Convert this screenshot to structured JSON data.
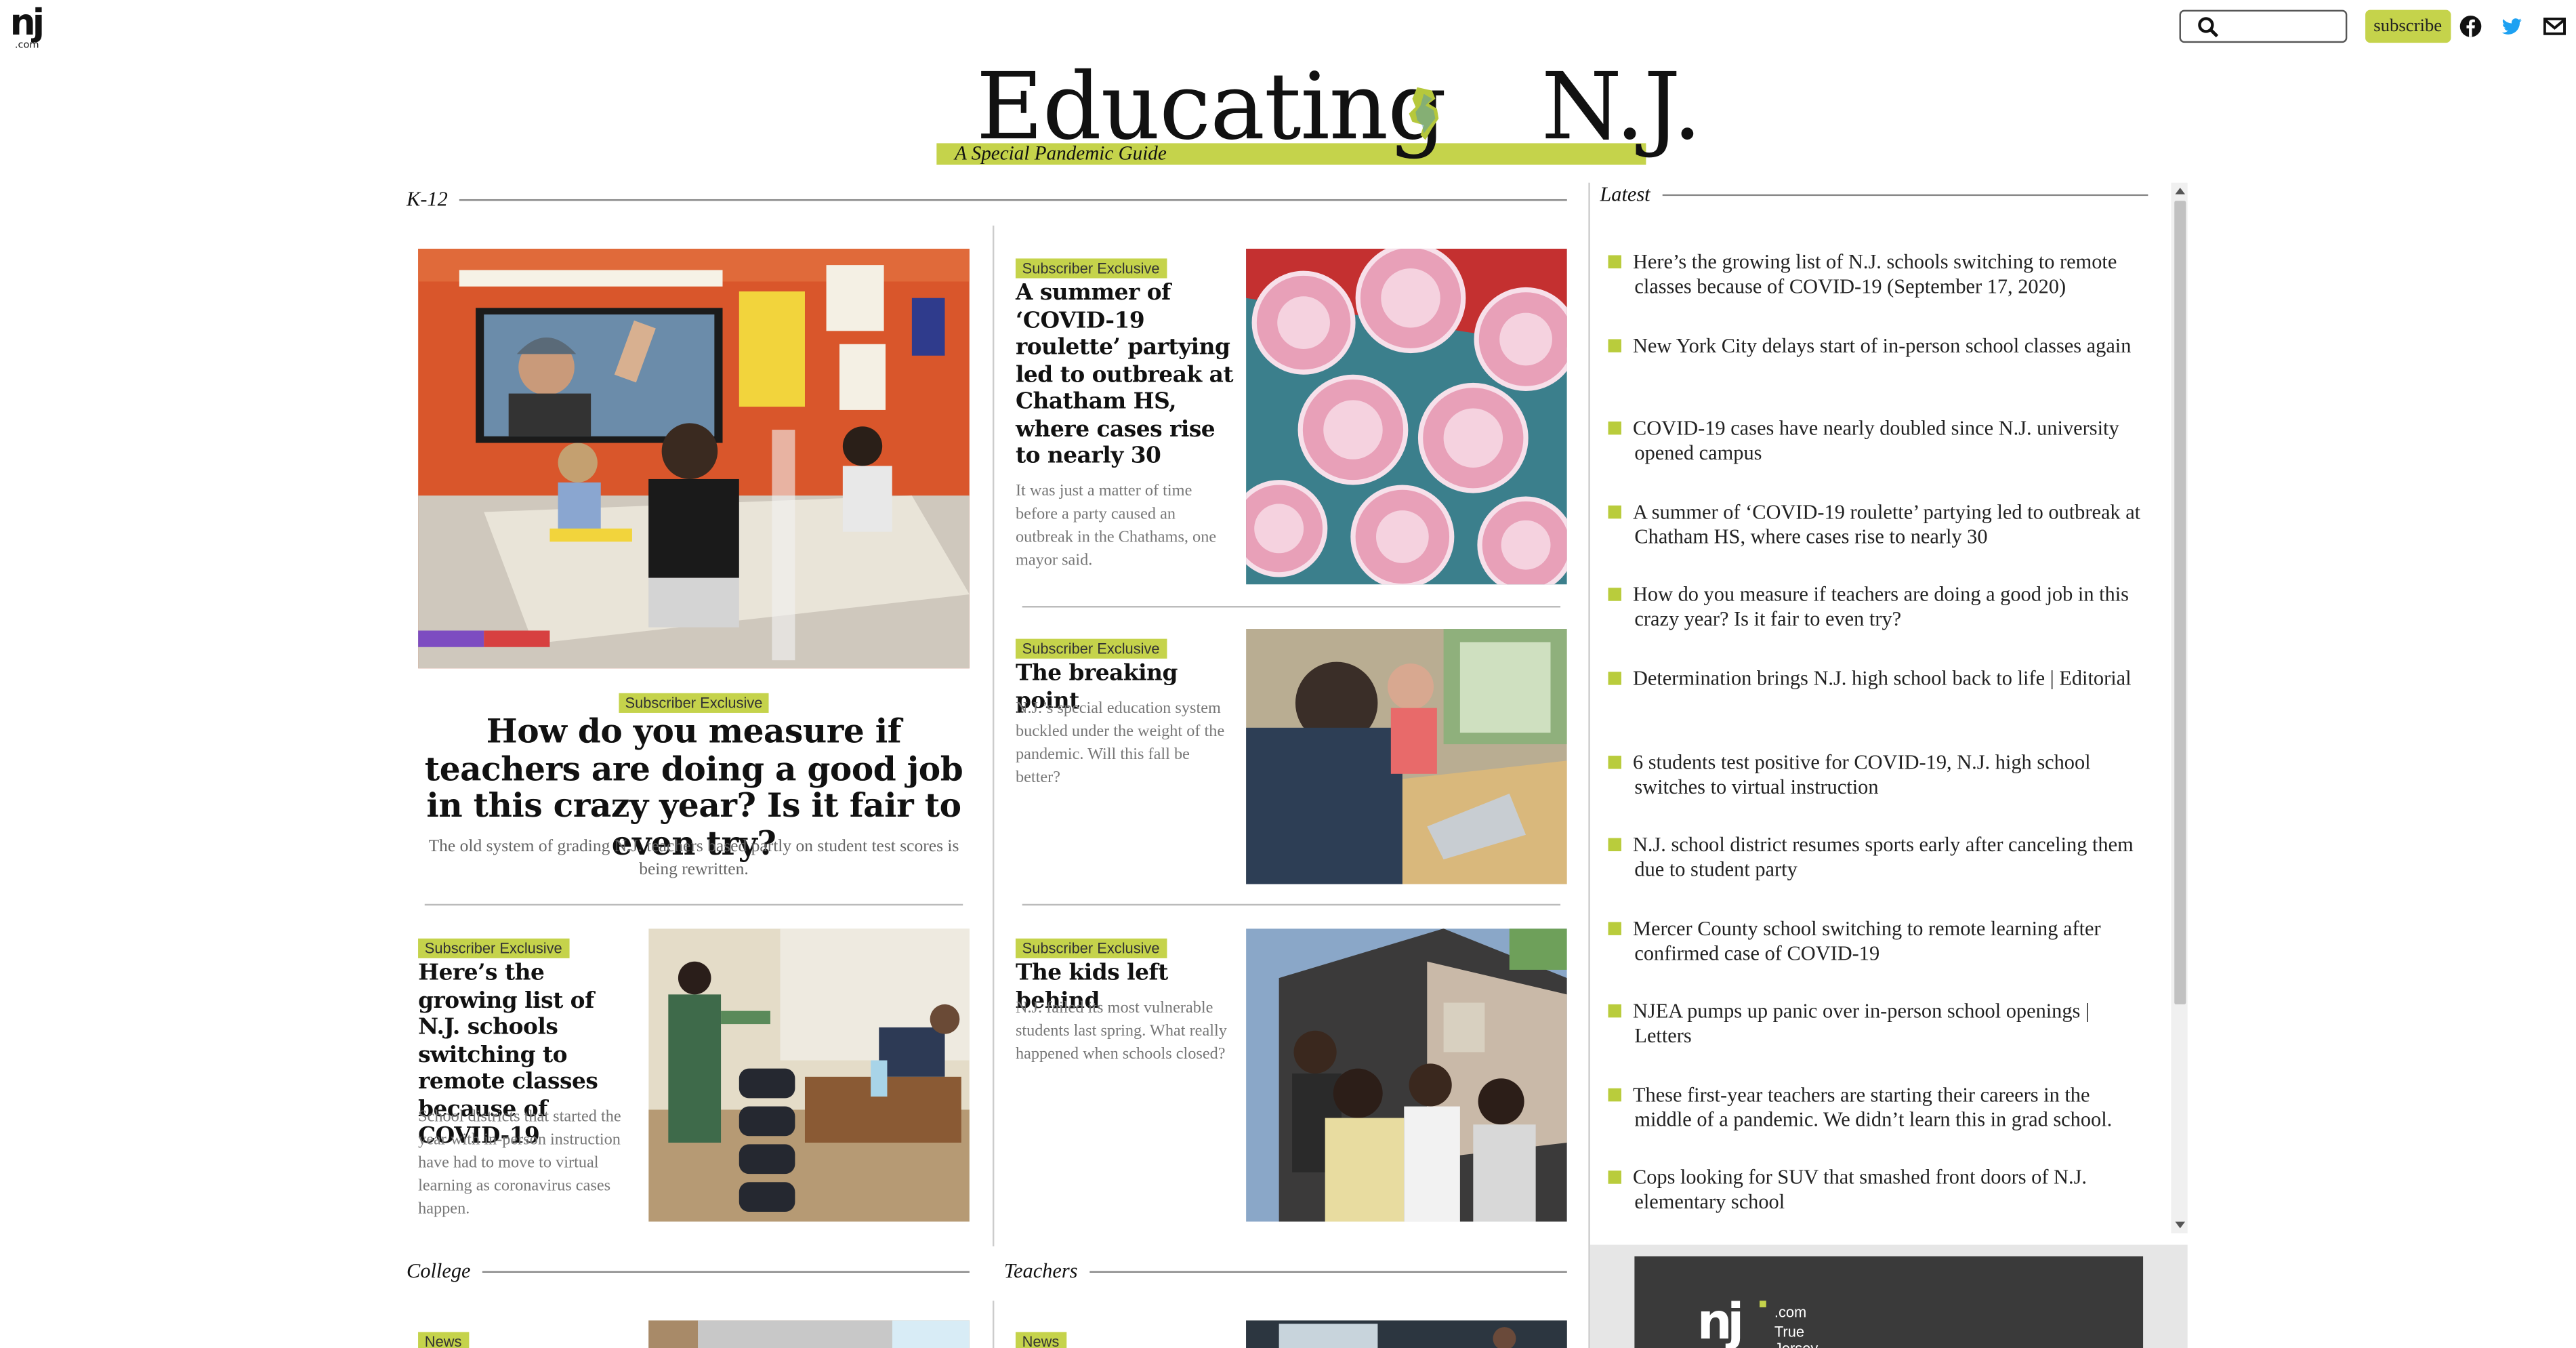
{
  "header": {
    "logo_text": "nj",
    "logo_sub": ".com",
    "search_placeholder": "",
    "subscribe_label": "subscribe",
    "social": [
      "facebook-icon",
      "twitter-icon",
      "mail-icon"
    ]
  },
  "masthead": {
    "title_left": "Educating",
    "title_right": "N.J.",
    "subtitle": "A Special Pandemic Guide",
    "accent": "#c5d34b"
  },
  "sections": {
    "k12": "K-12",
    "latest": "Latest",
    "college": "College",
    "teachers": "Teachers"
  },
  "lead": {
    "badge": "Subscriber Exclusive",
    "headline": "How do you measure if teachers are doing a good job in this crazy year? Is it fair to even try?",
    "dek": "The old system of grading N.J. teachers based partly on student test scores is being rewritten."
  },
  "cards": [
    {
      "badge": "Subscriber Exclusive",
      "headline": "A summer of ‘COVID-19 roulette’ partying led to outbreak at Chatham HS, where cases rise to nearly 30",
      "dek": "It was just a matter of time before a party caused an outbreak in the Chathams, one mayor said."
    },
    {
      "badge": "Subscriber Exclusive",
      "headline": "The breaking point",
      "dek": "N.J.’s special education system buckled under the weight of the pandemic. Will this fall be better?"
    },
    {
      "badge": "Subscriber Exclusive",
      "headline": "Here’s the growing list of N.J. schools switching to remote classes because of COVID-19",
      "dek": "School districts that started the year with in-person instruction have had to move to virtual learning as coronavirus cases happen."
    },
    {
      "badge": "Subscriber Exclusive",
      "headline": "The kids left behind",
      "dek": "N.J. failed its most vulnerable students last spring. What really happened when schools closed?"
    }
  ],
  "bottom_badges": [
    "News",
    "News"
  ],
  "latest": [
    "Here’s the growing list of N.J. schools switching to remote classes because of COVID-19 (September 17, 2020)",
    "New York City delays start of in-person school classes again",
    "COVID-19 cases have nearly doubled since N.J. university opened campus",
    "A summer of ‘COVID-19 roulette’ partying led to outbreak at Chatham HS, where cases rise to nearly 30",
    "How do you measure if teachers are doing a good job in this crazy year? Is it fair to even try?",
    "Determination brings N.J. high school back to life | Editorial",
    "6 students test positive for COVID-19, N.J. high school switches to virtual instruction",
    "N.J. school district resumes sports early after canceling them due to student party",
    "Mercer County school switching to remote learning after confirmed case of COVID-19",
    "NJEA pumps up panic over in-person school openings | Letters",
    "These first-year teachers are starting their careers in the middle of a pandemic. We didn’t learn this in grad school.",
    "Cops looking for SUV that smashed front doors of N.J. elementary school"
  ],
  "ad": {
    "logo": "nj",
    "logo_sub": ".com",
    "tagline_1": "True",
    "tagline_2": "Jersey"
  }
}
